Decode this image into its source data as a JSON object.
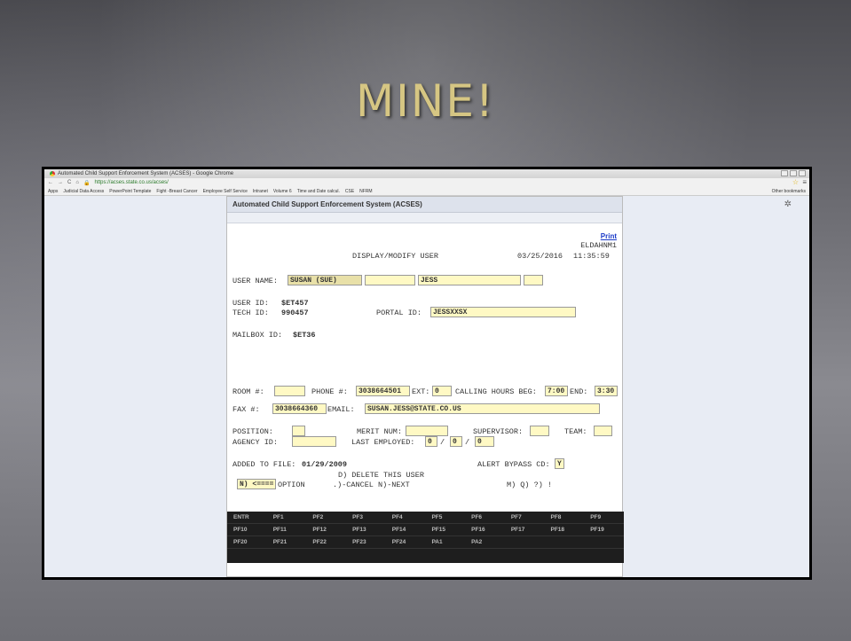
{
  "slide": {
    "title": "MINE!"
  },
  "browser": {
    "window_title": "Automated Child Support Enforcement System (ACSES) - Google Chrome",
    "url": "https://acses.state.co.us/acses/",
    "bookmarks": [
      "Apps",
      "Judicial Data Access",
      "PowerPoint Template",
      "Fight -Breast Cancer",
      "Employee Self Service",
      "Intranet",
      "Volume 6",
      "Time and Date calcul.",
      "CSE",
      "NFRM"
    ],
    "other_bookmarks": "Other bookmarks"
  },
  "app": {
    "header": "Automated Child Support Enforcement System (ACSES)",
    "print_label": "Print",
    "screen_code": "ELDAHNM1",
    "screen_title": "DISPLAY/MODIFY USER",
    "date": "03/25/2016",
    "time": "11:35:59",
    "user_name_label": "USER NAME:",
    "first_name": "SUSAN (SUE)",
    "middle_name": "",
    "last_name": "JESS",
    "suffix": "",
    "user_id_label": "USER ID:",
    "user_id": "$ET457",
    "tech_id_label": "TECH ID:",
    "tech_id": "990457",
    "portal_id_label": "PORTAL ID:",
    "portal_id": "JESSXXSX",
    "mailbox_label": "MAILBOX ID:",
    "mailbox_id": "$ET36",
    "room_label": "ROOM #:",
    "room": "",
    "phone_label": "PHONE #:",
    "phone": "3038664501",
    "ext_label": "EXT:",
    "ext": "0",
    "calling_hours_label": "CALLING HOURS BEG:",
    "calling_beg": "7:00",
    "end_label": "END:",
    "calling_end": "3:30",
    "fax_label": "FAX #:",
    "fax": "3038664360",
    "email_label": "EMAIL:",
    "email": "SUSAN.JESS@STATE.CO.US",
    "position_label": "POSITION:",
    "position": "",
    "merit_label": "MERIT NUM:",
    "merit": "",
    "supervisor_label": "SUPERVISOR:",
    "supervisor": "",
    "team_label": "TEAM:",
    "team": "",
    "agency_label": "AGENCY ID:",
    "agency": "",
    "last_employed_label": "LAST EMPLOYED:",
    "last_emp_m": "0",
    "last_emp_d": "0",
    "last_emp_y": "0",
    "slash": "/",
    "added_label": "ADDED TO FILE:",
    "added_date": "01/29/2009",
    "alert_label": "ALERT BYPASS CD:",
    "alert_value": "Y",
    "delete_text": "D) DELETE THIS USER",
    "option_value": "N) <====",
    "option_label": "OPTION",
    "cancel_next": ".)-CANCEL  N)-NEXT",
    "other_opts": "M) Q) ?) !",
    "fkeys_row1": [
      "ENTR",
      "PF1",
      "PF2",
      "PF3",
      "PF4",
      "PF5",
      "PF6",
      "PF7",
      "PF8",
      "PF9"
    ],
    "fkeys_row2": [
      "PF10",
      "PF11",
      "PF12",
      "PF13",
      "PF14",
      "PF15",
      "PF16",
      "PF17",
      "PF18",
      "PF19"
    ],
    "fkeys_row3": [
      "PF20",
      "PF21",
      "PF22",
      "PF23",
      "PF24",
      "PA1",
      "PA2"
    ]
  }
}
